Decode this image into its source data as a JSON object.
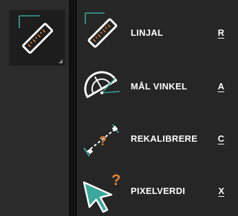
{
  "toolbar": {
    "active_tool_icon": "ruler-icon"
  },
  "menu": {
    "items": [
      {
        "label": "LINJAL",
        "shortcut": "R",
        "icon": "ruler-icon"
      },
      {
        "label": "MÅL VINKEL",
        "shortcut": "A",
        "icon": "protractor-icon"
      },
      {
        "label": "REKALIBRERE",
        "shortcut": "C",
        "icon": "recalibrate-icon"
      },
      {
        "label": "PIXELVERDI",
        "shortcut": "X",
        "icon": "pixel-value-icon"
      }
    ]
  },
  "colors": {
    "accent_teal": "#3aa89a",
    "accent_orange": "#e2832f",
    "menu_bg": "#262626",
    "strip_bg": "#2c2c2c",
    "divider": "#101010"
  }
}
